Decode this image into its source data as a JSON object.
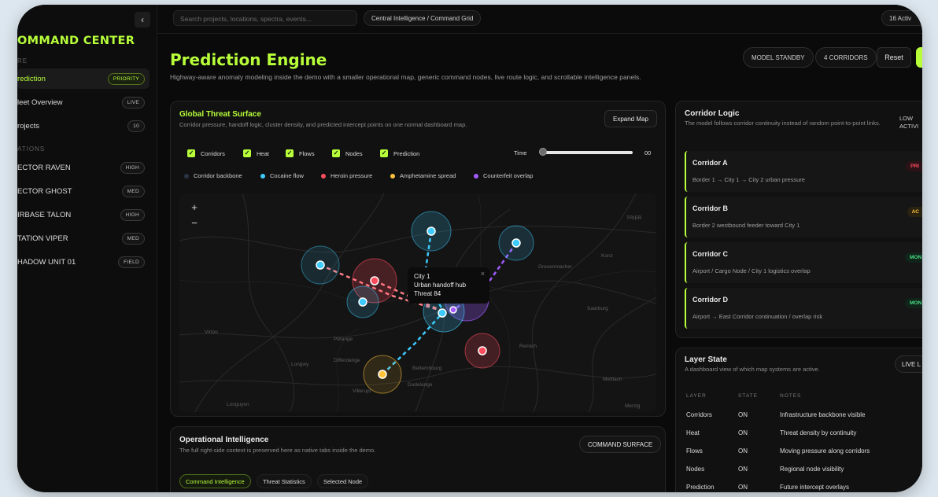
{
  "sidebar": {
    "brand": "OMMAND CENTER",
    "section_core": "RE",
    "section_ops": "ATIONS",
    "items": [
      {
        "label": "rediction",
        "badge": "PRIORITY"
      },
      {
        "label": "leet Overview",
        "badge": "LIVE"
      },
      {
        "label": "rojects",
        "badge": "10"
      },
      {
        "label": "ECTOR RAVEN",
        "badge": "HIGH"
      },
      {
        "label": "ECTOR GHOST",
        "badge": "MED"
      },
      {
        "label": "IRBASE TALON",
        "badge": "HIGH"
      },
      {
        "label": "TATION VIPER",
        "badge": "MED"
      },
      {
        "label": "HADOW UNIT 01",
        "badge": "FIELD"
      }
    ]
  },
  "topbar": {
    "search_placeholder": "Search projects, locations, spectra, events...",
    "breadcrumb": "Central Intelligence / Command Grid",
    "active_count": "16 Activ"
  },
  "header": {
    "title": "Prediction Engine",
    "subtitle": "Highway-aware anomaly modeling inside the demo with a smaller operational map, generic command nodes, live route logic, and scrollable intelligence panels.",
    "model_status": "MODEL STANDBY",
    "corridor_count": "4 CORRIDORS",
    "reset_label": "Reset"
  },
  "threat_surface": {
    "title": "Global Threat Surface",
    "subtitle": "Corridor pressure, handoff logic, cluster density, and predicted intercept points on one normal dashboard map.",
    "expand_label": "Expand Map",
    "toggles": [
      "Corridors",
      "Heat",
      "Flows",
      "Nodes",
      "Prediction"
    ],
    "time_label": "Time",
    "time_value": "00",
    "time_fraction": 0.0,
    "legend": [
      {
        "label": "Corridor backbone",
        "color": "#2a3447"
      },
      {
        "label": "Cocaine flow",
        "color": "#3ecbff"
      },
      {
        "label": "Heroin pressure",
        "color": "#ff4d5e"
      },
      {
        "label": "Amphetamine spread",
        "color": "#ffc23a"
      },
      {
        "label": "Counterfeit overlap",
        "color": "#a35bff"
      }
    ],
    "map_labels": [
      "TRIER",
      "Grevenmacher",
      "Konz",
      "Saarburg",
      "Remich",
      "Virton",
      "Pétange",
      "Longwy",
      "Differdange",
      "Bettembourg",
      "Dudelange",
      "Villerupt",
      "Longuyon",
      "Mettlach",
      "Merzig"
    ],
    "popup": {
      "line1": "City 1",
      "line2": "Urban handoff hub",
      "line3": "Threat 84",
      "close": "×"
    }
  },
  "ops_intel": {
    "title": "Operational Intelligence",
    "subtitle": "The full right-side context is preserved here as native tabs inside the demo.",
    "button": "COMMAND SURFACE",
    "tabs": [
      "Command Intelligence",
      "Threat Statistics",
      "Selected Node"
    ]
  },
  "corridor_logic": {
    "title": "Corridor Logic",
    "subtitle": "The model follows corridor continuity instead of random point-to-point links.",
    "status": "LOW ACTIVI",
    "corridors": [
      {
        "name": "Corridor A",
        "route": "Border 1 → City 1 → City 2 urban pressure",
        "tag": "PRI",
        "tag_color": "#ff4d5e"
      },
      {
        "name": "Corridor B",
        "route": "Border 2 westbound feeder toward City 1",
        "tag": "AC",
        "tag_color": "#ffc23a"
      },
      {
        "name": "Corridor C",
        "route": "Airport / Cargo Node / City 1 logistics overlap",
        "tag": "MON",
        "tag_color": "#4ade80"
      },
      {
        "name": "Corridor D",
        "route": "Airport → East Corridor continuation / overlap risk",
        "tag": "MON",
        "tag_color": "#4ade80"
      }
    ]
  },
  "layer_state": {
    "title": "Layer State",
    "subtitle": "A dashboard view of which map systems are active.",
    "badge": "LIVE L",
    "headers": [
      "LAYER",
      "STATE",
      "NOTES"
    ],
    "rows": [
      {
        "layer": "Corridors",
        "state": "ON",
        "notes": "Infrastructure backbone visible"
      },
      {
        "layer": "Heat",
        "state": "ON",
        "notes": "Threat density by continuity"
      },
      {
        "layer": "Flows",
        "state": "ON",
        "notes": "Moving pressure along corridors"
      },
      {
        "layer": "Nodes",
        "state": "ON",
        "notes": "Regional node visibility"
      },
      {
        "layer": "Prediction",
        "state": "ON",
        "notes": "Future intercept overlays"
      }
    ]
  },
  "colors": {
    "accent": "#b8ff3a",
    "background": "#0a0a0a"
  }
}
